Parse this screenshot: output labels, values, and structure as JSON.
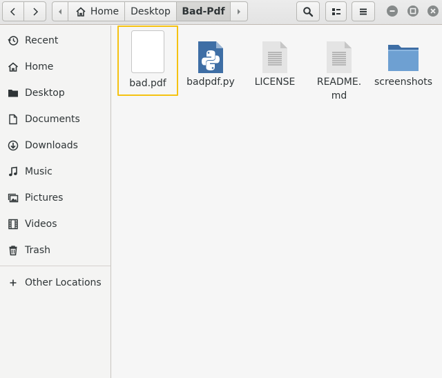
{
  "header": {
    "path": [
      "Home",
      "Desktop",
      "Bad-Pdf"
    ],
    "current_folder": "Bad-Pdf"
  },
  "sidebar": {
    "items": [
      {
        "label": "Recent",
        "icon": "clock-icon"
      },
      {
        "label": "Home",
        "icon": "home-icon"
      },
      {
        "label": "Desktop",
        "icon": "folder-icon"
      },
      {
        "label": "Documents",
        "icon": "document-icon"
      },
      {
        "label": "Downloads",
        "icon": "download-icon"
      },
      {
        "label": "Music",
        "icon": "music-icon"
      },
      {
        "label": "Pictures",
        "icon": "pictures-icon"
      },
      {
        "label": "Videos",
        "icon": "film-icon"
      },
      {
        "label": "Trash",
        "icon": "trash-icon"
      }
    ],
    "other_locations": "Other Locations"
  },
  "files": [
    {
      "name": "bad.pdf",
      "icon": "blank-document-icon",
      "selected": true
    },
    {
      "name": "badpdf.py",
      "icon": "python-file-icon"
    },
    {
      "name": "LICENSE",
      "icon": "text-file-icon"
    },
    {
      "name": "README.md",
      "icon": "text-file-icon",
      "display_lines": [
        "README.",
        "md"
      ]
    },
    {
      "name": "screenshots",
      "icon": "folder-icon"
    }
  ],
  "colors": {
    "selection": "#f5c211",
    "folder": "#5e94c8",
    "python": "#3e6ea5"
  }
}
